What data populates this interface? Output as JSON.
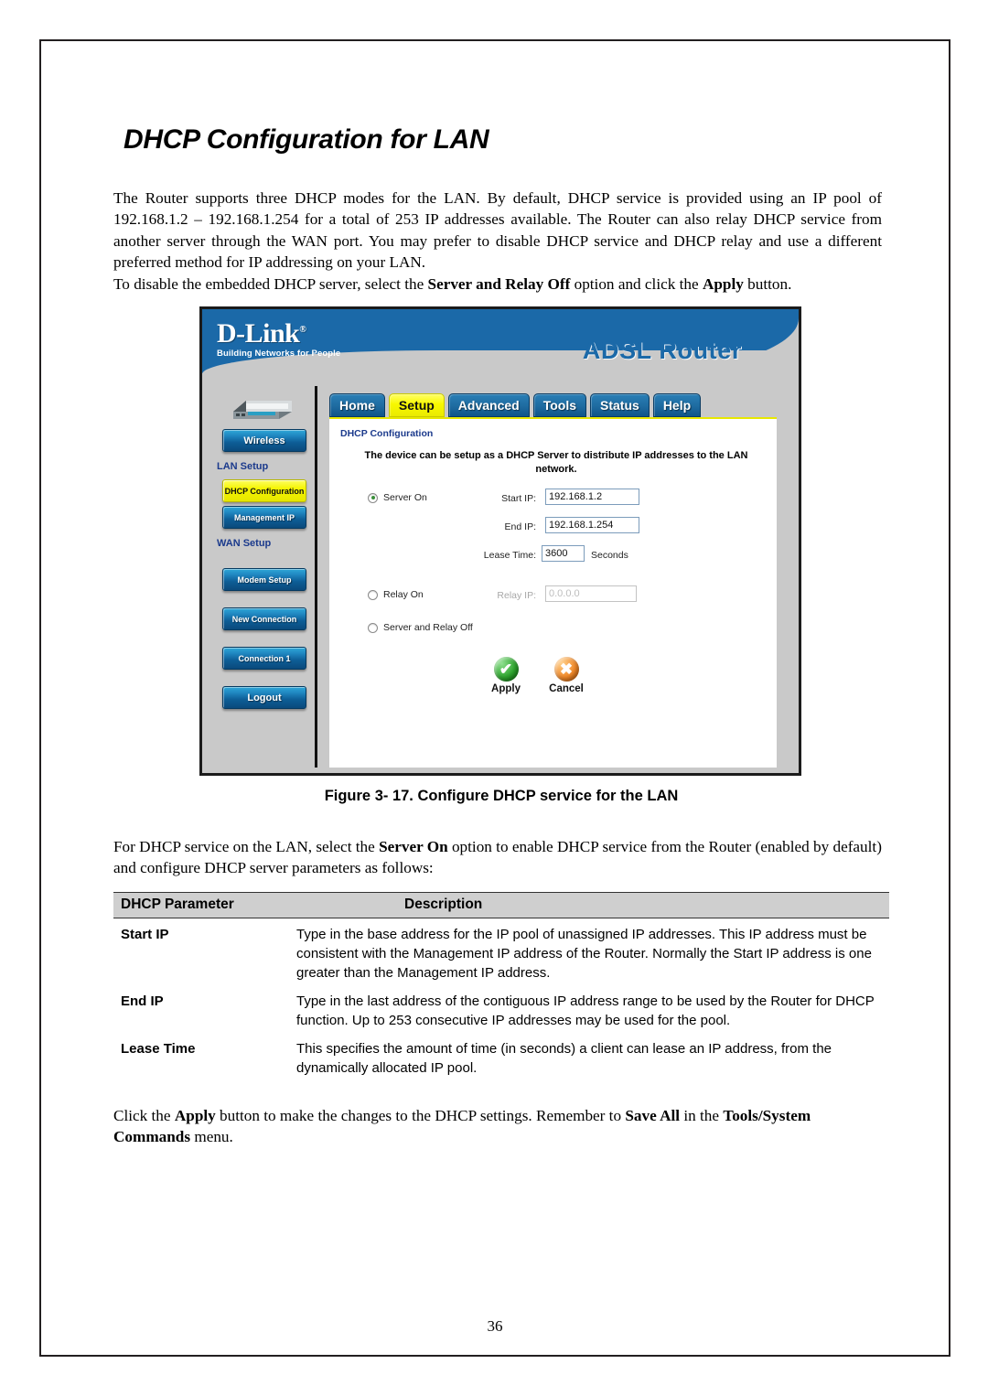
{
  "document": {
    "title": "DHCP Configuration for LAN",
    "page_number": "36",
    "paragraphs": {
      "intro_1": "The Router supports three DHCP modes for the LAN. By default, DHCP service is provided using an IP pool of 192.168.1.2 – 192.168.1.254 for a total of 253 IP addresses available. The Router can also relay DHCP service from another server through the WAN port. You may prefer to disable DHCP service and DHCP relay and use a different preferred method for IP addressing on your LAN.",
      "intro_2_part1": "To disable the embedded DHCP server, select the ",
      "intro_2_bold1": "Server and Relay Off",
      "intro_2_part2": " option and click the ",
      "intro_2_bold2": "Apply",
      "intro_2_part3": " button.",
      "after_fig_part1": "For DHCP service on the LAN, select the ",
      "after_fig_bold1": "Server On",
      "after_fig_part2": " option to enable DHCP service from the Router (enabled by default) and configure DHCP server parameters as follows:",
      "closing_part1": "Click the ",
      "closing_bold1": "Apply",
      "closing_part2": " button to make the changes to the DHCP settings. Remember to ",
      "closing_bold2": "Save All",
      "closing_part3": " in the ",
      "closing_bold3": "Tools/System Commands",
      "closing_part4": " menu."
    },
    "figure_caption": "Figure 3- 17. Configure DHCP service for the LAN"
  },
  "table": {
    "headers": [
      "DHCP Parameter",
      "Description"
    ],
    "rows": [
      {
        "parameter": "Start IP",
        "description": "Type in the base address for the IP pool of unassigned IP addresses. This IP address must be consistent with the Management IP address of the Router. Normally the Start IP address is one greater than the Management IP address."
      },
      {
        "parameter": "End IP",
        "description": "Type in the last address of the contiguous IP address range to be used by the Router for DHCP function. Up to 253 consecutive IP addresses may be used for the pool."
      },
      {
        "parameter": "Lease Time",
        "description": "This specifies the amount of time (in seconds) a client can lease an IP address, from the dynamically allocated IP pool."
      }
    ]
  },
  "router_ui": {
    "brand": "D-Link",
    "brand_registered": "®",
    "brand_tagline": "Building Networks for People",
    "product_name": "ADSL Router",
    "tabs": [
      {
        "label": "Home",
        "active": false
      },
      {
        "label": "Setup",
        "active": true
      },
      {
        "label": "Advanced",
        "active": false
      },
      {
        "label": "Tools",
        "active": false
      },
      {
        "label": "Status",
        "active": false
      },
      {
        "label": "Help",
        "active": false
      }
    ],
    "sidebar": {
      "wireless_button": "Wireless",
      "group_lan": "LAN Setup",
      "lan_buttons": [
        {
          "label": "DHCP Configuration",
          "highlighted": true
        },
        {
          "label": "Management IP",
          "highlighted": false
        }
      ],
      "group_wan": "WAN Setup",
      "wan_buttons": [
        {
          "label": "Modem Setup",
          "highlighted": false
        },
        {
          "label": "New Connection",
          "highlighted": false
        },
        {
          "label": "Connection 1",
          "highlighted": false
        },
        {
          "label": "Logout",
          "highlighted": false
        }
      ]
    },
    "panel": {
      "heading": "DHCP Configuration",
      "subheading": "The device can be setup as a DHCP Server to distribute IP addresses to the LAN network.",
      "options": [
        {
          "label": "Server On",
          "selected": true
        },
        {
          "label": "Relay On",
          "selected": false
        },
        {
          "label": "Server and Relay Off",
          "selected": false
        }
      ],
      "fields": {
        "start_ip_label": "Start IP:",
        "start_ip_value": "192.168.1.2",
        "end_ip_label": "End IP:",
        "end_ip_value": "192.168.1.254",
        "lease_time_label": "Lease Time:",
        "lease_time_value": "3600",
        "lease_time_units": "Seconds",
        "relay_ip_label": "Relay IP:",
        "relay_ip_value": "0.0.0.0"
      },
      "buttons": {
        "apply_label": "Apply",
        "apply_glyph": "✔",
        "cancel_label": "Cancel",
        "cancel_glyph": "✖"
      }
    },
    "colors": {
      "brand_blue": "#1b69a8",
      "tab_active_yellow": "#f8f800",
      "sidebar_gray": "#c9c9c9",
      "heading_navy": "#1b3a8c"
    }
  }
}
